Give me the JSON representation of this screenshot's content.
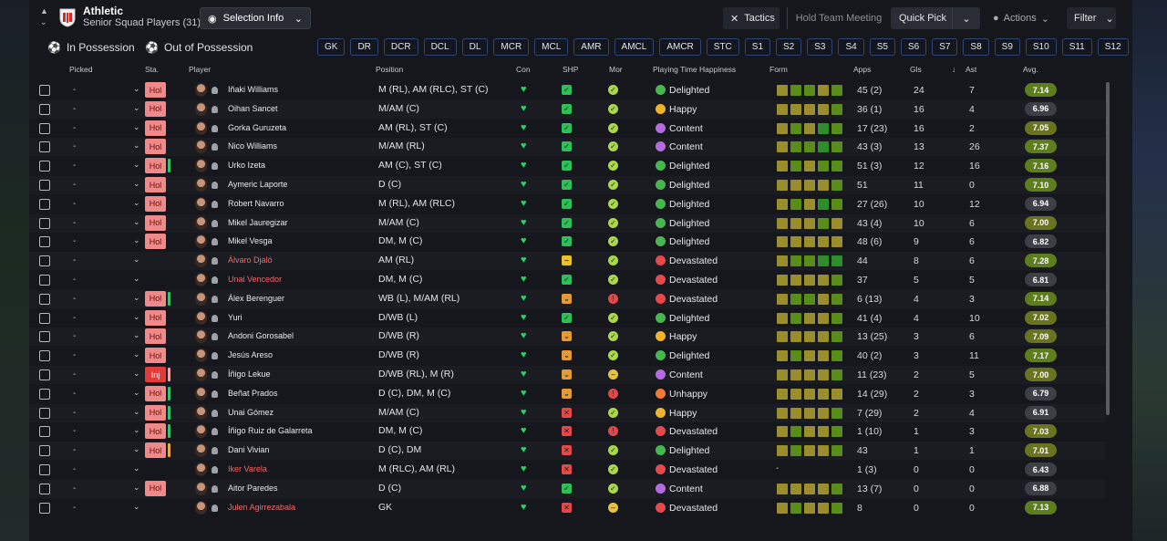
{
  "header": {
    "club": "Athletic",
    "squad": "Senior Squad Players (31)",
    "selection_info": "Selection Info",
    "tactics": "Tactics",
    "hold_meeting": "Hold Team Meeting",
    "quick_pick": "Quick Pick",
    "actions": "Actions",
    "filter": "Filter"
  },
  "possession": {
    "in": "In Possession",
    "out": "Out of Possession"
  },
  "chips": [
    "GK",
    "DR",
    "DCR",
    "DCL",
    "DL",
    "MCR",
    "MCL",
    "AMR",
    "AMCL",
    "AMCR",
    "STC",
    "S1",
    "S2",
    "S3",
    "S4",
    "S5",
    "S6",
    "S7",
    "S8",
    "S9",
    "S10",
    "S11",
    "S12"
  ],
  "columns": {
    "picked": "Picked",
    "sta": "Sta.",
    "player": "Player",
    "position": "Position",
    "con": "Con",
    "shp": "SHP",
    "mor": "Mor",
    "pth": "Playing Time Happiness",
    "form": "Form",
    "apps": "Apps",
    "gls": "Gls",
    "ast": "Ast",
    "avg": "Avg."
  },
  "colors": {
    "sta_fill": "#f08a8a",
    "inj_fill": "#e43a3a",
    "con": "#2fcf6a",
    "avg_green": "#5e7d1f",
    "avg_olive": "#6a7420",
    "avg_gray": "#3d3f46",
    "form_olive": "#9a8d2c",
    "form_green": "#5a8d18",
    "form_dgreen": "#2f8d2c"
  },
  "players": [
    {
      "picked": "-",
      "sta": "Hol",
      "bar": "",
      "name": "Iñaki Williams",
      "name_red": false,
      "position": "M (RL), AM (RLC), ST (C)",
      "shp": "ok",
      "mor": "ok",
      "happiness": "Delighted",
      "form": [
        "o",
        "g",
        "g",
        "o",
        "g"
      ],
      "apps": "45 (2)",
      "gls": "24",
      "ast": "7",
      "avg": "7.14"
    },
    {
      "picked": "-",
      "sta": "Hol",
      "bar": "",
      "name": "Oihan Sancet",
      "name_red": false,
      "position": "M/AM (C)",
      "shp": "ok",
      "mor": "ok",
      "happiness": "Happy",
      "form": [
        "o",
        "o",
        "o",
        "o",
        "g"
      ],
      "apps": "36 (1)",
      "gls": "16",
      "ast": "4",
      "avg": "6.96"
    },
    {
      "picked": "-",
      "sta": "Hol",
      "bar": "",
      "name": "Gorka Guruzeta",
      "name_red": false,
      "position": "AM (RL), ST (C)",
      "shp": "ok",
      "mor": "ok",
      "happiness": "Content",
      "form": [
        "o",
        "g",
        "o",
        "d",
        "g"
      ],
      "apps": "17 (23)",
      "gls": "16",
      "ast": "2",
      "avg": "7.05"
    },
    {
      "picked": "-",
      "sta": "Hol",
      "bar": "",
      "name": "Nico Williams",
      "name_red": false,
      "position": "M/AM (RL)",
      "shp": "ok",
      "mor": "ok",
      "happiness": "Content",
      "form": [
        "o",
        "g",
        "g",
        "d",
        "g"
      ],
      "apps": "43 (3)",
      "gls": "13",
      "ast": "26",
      "avg": "7.37"
    },
    {
      "picked": "-",
      "sta": "Hol",
      "bar": "g",
      "name": "Urko Izeta",
      "name_red": false,
      "position": "AM (C), ST (C)",
      "shp": "ok",
      "mor": "ok",
      "happiness": "Delighted",
      "form": [
        "o",
        "g",
        "o",
        "g",
        "g"
      ],
      "apps": "51 (3)",
      "gls": "12",
      "ast": "16",
      "avg": "7.16"
    },
    {
      "picked": "-",
      "sta": "Hol",
      "bar": "",
      "name": "Aymeric Laporte",
      "name_red": false,
      "position": "D (C)",
      "shp": "ok",
      "mor": "ok",
      "happiness": "Delighted",
      "form": [
        "o",
        "o",
        "o",
        "o",
        "g"
      ],
      "apps": "51",
      "gls": "11",
      "ast": "0",
      "avg": "7.10"
    },
    {
      "picked": "-",
      "sta": "Hol",
      "bar": "",
      "name": "Robert Navarro",
      "name_red": false,
      "position": "M (RL), AM (RLC)",
      "shp": "ok",
      "mor": "ok",
      "happiness": "Delighted",
      "form": [
        "o",
        "g",
        "o",
        "d",
        "g"
      ],
      "apps": "27 (26)",
      "gls": "10",
      "ast": "12",
      "avg": "6.94"
    },
    {
      "picked": "-",
      "sta": "Hol",
      "bar": "",
      "name": "Mikel Jauregizar",
      "name_red": false,
      "position": "M/AM (C)",
      "shp": "ok",
      "mor": "ok",
      "happiness": "Delighted",
      "form": [
        "o",
        "o",
        "o",
        "g",
        "o"
      ],
      "apps": "43 (4)",
      "gls": "10",
      "ast": "6",
      "avg": "7.00"
    },
    {
      "picked": "-",
      "sta": "Hol",
      "bar": "",
      "name": "Mikel Vesga",
      "name_red": false,
      "position": "DM, M (C)",
      "shp": "ok",
      "mor": "ok",
      "happiness": "Delighted",
      "form": [
        "o",
        "o",
        "o",
        "o",
        "o"
      ],
      "apps": "48 (6)",
      "gls": "9",
      "ast": "6",
      "avg": "6.82"
    },
    {
      "picked": "-",
      "sta": "",
      "bar": "",
      "name": "Álvaro Djaló",
      "name_red": true,
      "position": "AM (RL)",
      "shp": "mid",
      "mor": "ok",
      "happiness": "Devastated",
      "form": [
        "o",
        "g",
        "g",
        "d",
        "d"
      ],
      "apps": "44",
      "gls": "8",
      "ast": "6",
      "avg": "7.28"
    },
    {
      "picked": "-",
      "sta": "",
      "bar": "",
      "name": "Unai Vencedor",
      "name_red": true,
      "position": "DM, M (C)",
      "shp": "ok",
      "mor": "ok",
      "happiness": "Devastated",
      "form": [
        "o",
        "o",
        "o",
        "o",
        "g"
      ],
      "apps": "37",
      "gls": "5",
      "ast": "5",
      "avg": "6.81"
    },
    {
      "picked": "-",
      "sta": "Hol",
      "bar": "g",
      "name": "Álex Berenguer",
      "name_red": false,
      "position": "WB (L), M/AM (RL)",
      "shp": "low",
      "mor": "bad",
      "happiness": "Devastated",
      "form": [
        "o",
        "g",
        "g",
        "o",
        "g"
      ],
      "apps": "6 (13)",
      "gls": "4",
      "ast": "3",
      "avg": "7.14"
    },
    {
      "picked": "-",
      "sta": "Hol",
      "bar": "",
      "name": "Yuri",
      "name_red": false,
      "position": "D/WB (L)",
      "shp": "ok",
      "mor": "ok",
      "happiness": "Delighted",
      "form": [
        "o",
        "g",
        "o",
        "o",
        "g"
      ],
      "apps": "41 (4)",
      "gls": "4",
      "ast": "10",
      "avg": "7.02"
    },
    {
      "picked": "-",
      "sta": "Hol",
      "bar": "",
      "name": "Andoni Gorosabel",
      "name_red": false,
      "position": "D/WB (R)",
      "shp": "low",
      "mor": "ok",
      "happiness": "Happy",
      "form": [
        "o",
        "o",
        "o",
        "o",
        "g"
      ],
      "apps": "13 (25)",
      "gls": "3",
      "ast": "6",
      "avg": "7.09"
    },
    {
      "picked": "-",
      "sta": "Hol",
      "bar": "",
      "name": "Jesús Areso",
      "name_red": false,
      "position": "D/WB (R)",
      "shp": "low",
      "mor": "ok",
      "happiness": "Delighted",
      "form": [
        "o",
        "g",
        "o",
        "o",
        "g"
      ],
      "apps": "40 (2)",
      "gls": "3",
      "ast": "11",
      "avg": "7.17"
    },
    {
      "picked": "-",
      "sta": "Inj",
      "bar": "p",
      "name": "Íñigo Lekue",
      "name_red": false,
      "position": "D/WB (RL), M (R)",
      "shp": "low",
      "mor": "mid",
      "happiness": "Content",
      "form": [
        "o",
        "o",
        "o",
        "o",
        "g"
      ],
      "apps": "11 (23)",
      "gls": "2",
      "ast": "5",
      "avg": "7.00"
    },
    {
      "picked": "-",
      "sta": "Hol",
      "bar": "g",
      "name": "Beñat Prados",
      "name_red": false,
      "position": "D (C), DM, M (C)",
      "shp": "low",
      "mor": "bad",
      "happiness": "Unhappy",
      "form": [
        "o",
        "o",
        "o",
        "o",
        "o"
      ],
      "apps": "14 (29)",
      "gls": "2",
      "ast": "3",
      "avg": "6.79"
    },
    {
      "picked": "-",
      "sta": "Hol",
      "bar": "g",
      "name": "Unai Gómez",
      "name_red": false,
      "position": "M/AM (C)",
      "shp": "bad",
      "mor": "ok",
      "happiness": "Happy",
      "form": [
        "o",
        "o",
        "o",
        "o",
        "g"
      ],
      "apps": "7 (29)",
      "gls": "2",
      "ast": "4",
      "avg": "6.91"
    },
    {
      "picked": "-",
      "sta": "Hol",
      "bar": "g",
      "name": "Íñigo Ruiz de Galarreta",
      "name_red": false,
      "position": "DM, M (C)",
      "shp": "bad",
      "mor": "bad",
      "happiness": "Devastated",
      "form": [
        "o",
        "g",
        "o",
        "o",
        "g"
      ],
      "apps": "1 (10)",
      "gls": "1",
      "ast": "3",
      "avg": "7.03"
    },
    {
      "picked": "-",
      "sta": "Hol",
      "bar": "y",
      "name": "Dani Vivian",
      "name_red": false,
      "position": "D (C), DM",
      "shp": "bad",
      "mor": "ok",
      "happiness": "Delighted",
      "form": [
        "o",
        "g",
        "o",
        "o",
        "g"
      ],
      "apps": "43",
      "gls": "1",
      "ast": "1",
      "avg": "7.01"
    },
    {
      "picked": "-",
      "sta": "",
      "bar": "",
      "name": "Iker Varela",
      "name_red": true,
      "position": "M (RLC), AM (RL)",
      "shp": "bad",
      "mor": "ok",
      "happiness": "Devastated",
      "form": [],
      "apps": "1 (3)",
      "gls": "0",
      "ast": "0",
      "avg": "6.43"
    },
    {
      "picked": "-",
      "sta": "Hol",
      "bar": "",
      "name": "Aitor Paredes",
      "name_red": false,
      "position": "D (C)",
      "shp": "ok",
      "mor": "ok",
      "happiness": "Content",
      "form": [
        "o",
        "o",
        "o",
        "o",
        "g"
      ],
      "apps": "13 (7)",
      "gls": "0",
      "ast": "0",
      "avg": "6.88"
    },
    {
      "picked": "-",
      "sta": "",
      "bar": "",
      "name": "Julen Agirrezabala",
      "name_red": true,
      "position": "GK",
      "shp": "bad",
      "mor": "mid",
      "happiness": "Devastated",
      "form": [
        "o",
        "g",
        "o",
        "o",
        "g"
      ],
      "apps": "8",
      "gls": "0",
      "ast": "0",
      "avg": "7.13"
    }
  ]
}
